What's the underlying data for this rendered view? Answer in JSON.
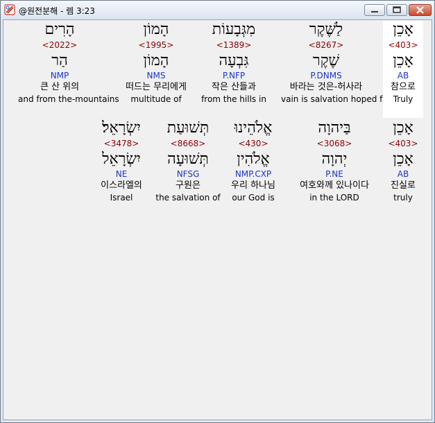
{
  "window": {
    "title": "@원전분해 - 렘 3:23"
  },
  "rows": [
    [
      {
        "heb": "הָרִים",
        "strong": "<2022>",
        "lemma": "הַר",
        "gram": "NMP",
        "kor": "큰 산 위의",
        "eng": "and from the-mountains"
      },
      {
        "heb": "הָמוֹן",
        "strong": "<1995>",
        "lemma": "הָמוֹן",
        "gram": "NMS",
        "kor": "떠드는 무리에게",
        "eng": "multitude of"
      },
      {
        "heb": "מִגְּבָעוֹת",
        "strong": "<1389>",
        "lemma": "גִּבְעָה",
        "gram": "P.NFP",
        "kor": "작은 산들과",
        "eng": "from the hills in"
      },
      {
        "heb": "לַשֶּׁקֶר",
        "strong": "<8267>",
        "lemma": "שֶׁקֶר",
        "gram": "P.DNMS",
        "kor": "바라는 것은-허사라",
        "eng": "vain is salvation hoped for"
      },
      {
        "heb": "אָכֵן",
        "strong": "<403>",
        "lemma": "אָכֵן",
        "gram": "AB",
        "kor": "참으로",
        "eng": "Truly"
      }
    ],
    [
      {
        "heb": "יִשְׂרָאֵל׃",
        "strong": "<3478>",
        "lemma": "יִשְׂרָאֵל",
        "gram": "NE",
        "kor": "이스라엘의",
        "eng": "Israel"
      },
      {
        "heb": "תְּשׁוּעַת",
        "strong": "<8668>",
        "lemma": "תְּשׁוּעָה",
        "gram": "NFSG",
        "kor": "구원은",
        "eng": "the salvation of"
      },
      {
        "heb": "אֱלֹהֵינוּ",
        "strong": "<430>",
        "lemma": "אֱלֹהִין",
        "gram": "NMP.CXP",
        "kor": "우리 하나님",
        "eng": "our God is"
      },
      {
        "heb": "בַּיהוָה",
        "strong": "<3068>",
        "lemma": "יְהוָה",
        "gram": "P.NE",
        "kor": "여호와께 있나이다",
        "eng": "in the LORD"
      },
      {
        "heb": "אָכֵן",
        "strong": "<403>",
        "lemma": "אָכֵן",
        "gram": "AB",
        "kor": "진실로",
        "eng": "truly"
      }
    ]
  ]
}
